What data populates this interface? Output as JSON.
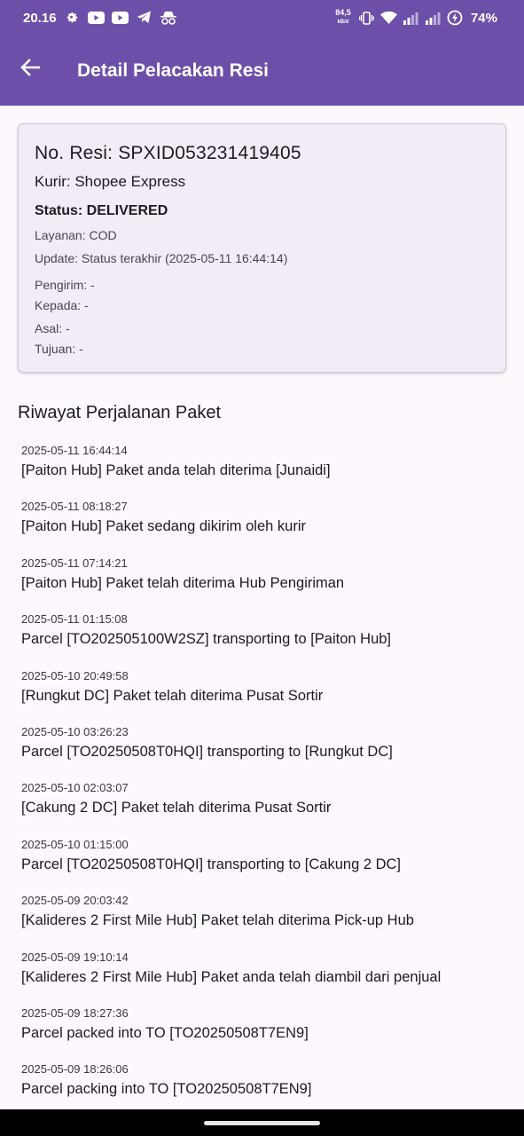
{
  "status_bar": {
    "time": "20.16",
    "speed_value": "84,5",
    "speed_unit": "kB/d",
    "battery": "74%",
    "icons": [
      "settings-icon",
      "youtube-icon",
      "youtube-icon",
      "telegram-icon",
      "incognito-icon",
      "vibrate-icon",
      "wifi-icon",
      "signal-icon",
      "signal-icon",
      "battery-icon"
    ]
  },
  "header": {
    "title": "Detail Pelacakan Resi",
    "back_icon": "arrow-left-icon",
    "color": "#6b4fa8"
  },
  "card": {
    "resi": "No. Resi: SPXID053231419405",
    "kurir": "Kurir: Shopee Express",
    "status": "Status: DELIVERED",
    "layanan": "Layanan: COD",
    "update": "Update: Status terakhir (2025-05-11 16:44:14)",
    "pengirim": "Pengirim: -",
    "kepada": "Kepada: -",
    "asal": "Asal: -",
    "tujuan": "Tujuan: -"
  },
  "history": {
    "title": "Riwayat Perjalanan Paket",
    "items": [
      {
        "date": "2025-05-11 16:44:14",
        "desc": "[Paiton Hub] Paket anda telah diterima [Junaidi]"
      },
      {
        "date": "2025-05-11 08:18:27",
        "desc": "[Paiton Hub] Paket sedang dikirim oleh kurir"
      },
      {
        "date": "2025-05-11 07:14:21",
        "desc": "[Paiton Hub] Paket telah diterima Hub Pengiriman"
      },
      {
        "date": "2025-05-11 01:15:08",
        "desc": "Parcel [TO202505100W2SZ] transporting to [Paiton Hub]"
      },
      {
        "date": "2025-05-10 20:49:58",
        "desc": "[Rungkut DC] Paket telah diterima Pusat Sortir"
      },
      {
        "date": "2025-05-10 03:26:23",
        "desc": "Parcel [TO20250508T0HQI] transporting to [Rungkut DC]"
      },
      {
        "date": "2025-05-10 02:03:07",
        "desc": "[Cakung 2 DC] Paket telah diterima Pusat Sortir"
      },
      {
        "date": "2025-05-10 01:15:00",
        "desc": "Parcel [TO20250508T0HQI] transporting to [Cakung 2 DC]"
      },
      {
        "date": "2025-05-09 20:03:42",
        "desc": "[Kalideres 2 First Mile Hub] Paket telah diterima Pick-up Hub"
      },
      {
        "date": "2025-05-09 19:10:14",
        "desc": "[Kalideres 2 First Mile Hub] Paket anda telah diambil dari penjual"
      },
      {
        "date": "2025-05-09 18:27:36",
        "desc": "Parcel packed into TO [TO20250508T7EN9]"
      },
      {
        "date": "2025-05-09 18:26:06",
        "desc": "Parcel packing into TO [TO20250508T7EN9]"
      }
    ]
  }
}
